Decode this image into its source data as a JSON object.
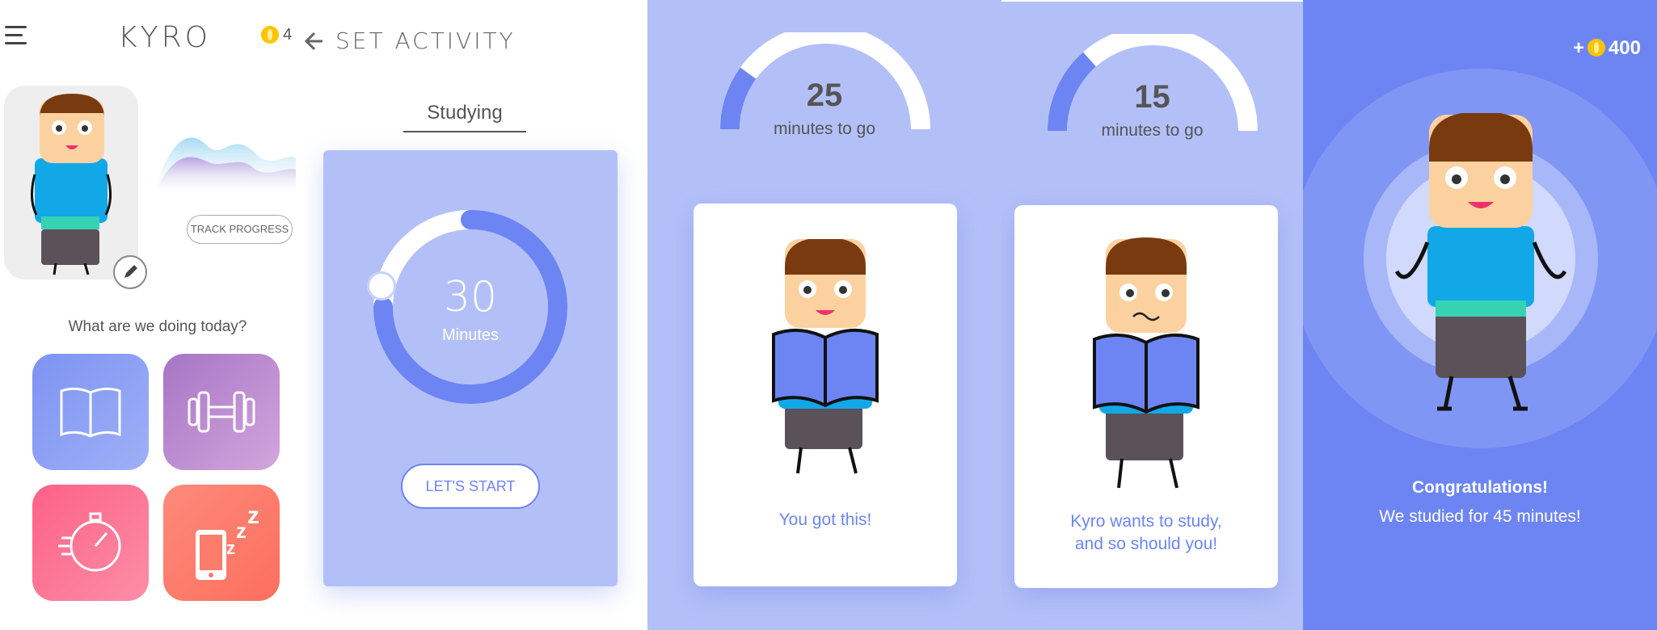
{
  "header": {
    "app_title": "KYRO",
    "coin_count": "4",
    "screen_title": "SET ACTIVITY"
  },
  "home": {
    "track_progress_label": "TRACK PROGRESS",
    "prompt": "What are we doing today?",
    "activities": [
      {
        "icon": "book-icon",
        "color_from": "#7d93f2",
        "color_to": "#9fb0f7"
      },
      {
        "icon": "dumbbell-icon",
        "color_from": "#a675c5",
        "color_to": "#d3a6dc"
      },
      {
        "icon": "stopwatch-icon",
        "color_from": "#fd6188",
        "color_to": "#fc8ea6"
      },
      {
        "icon": "phone-sleep-icon",
        "color_from": "#fd8a7b",
        "color_to": "#fd6f5e"
      }
    ]
  },
  "set_activity": {
    "tab_label": "Studying",
    "timer_value": "30",
    "timer_unit": "Minutes",
    "start_label": "LET'S START",
    "timer_progress": 0.75
  },
  "progress_screens": [
    {
      "minutes": "25",
      "label": "minutes to go",
      "message": "You got this!",
      "progress": 0.2
    },
    {
      "minutes": "15",
      "label": "minutes to go",
      "message_line1": "Kyro wants to study,",
      "message_line2": "and so should you!",
      "progress": 0.27
    }
  ],
  "congrats_screen": {
    "reward": "400",
    "title": "Congratulations!",
    "subtitle": "We studied for 45 minutes!"
  },
  "colors": {
    "accent": "#6d85f2",
    "light_accent": "#b3c0f8",
    "coin": "#ffc400"
  }
}
